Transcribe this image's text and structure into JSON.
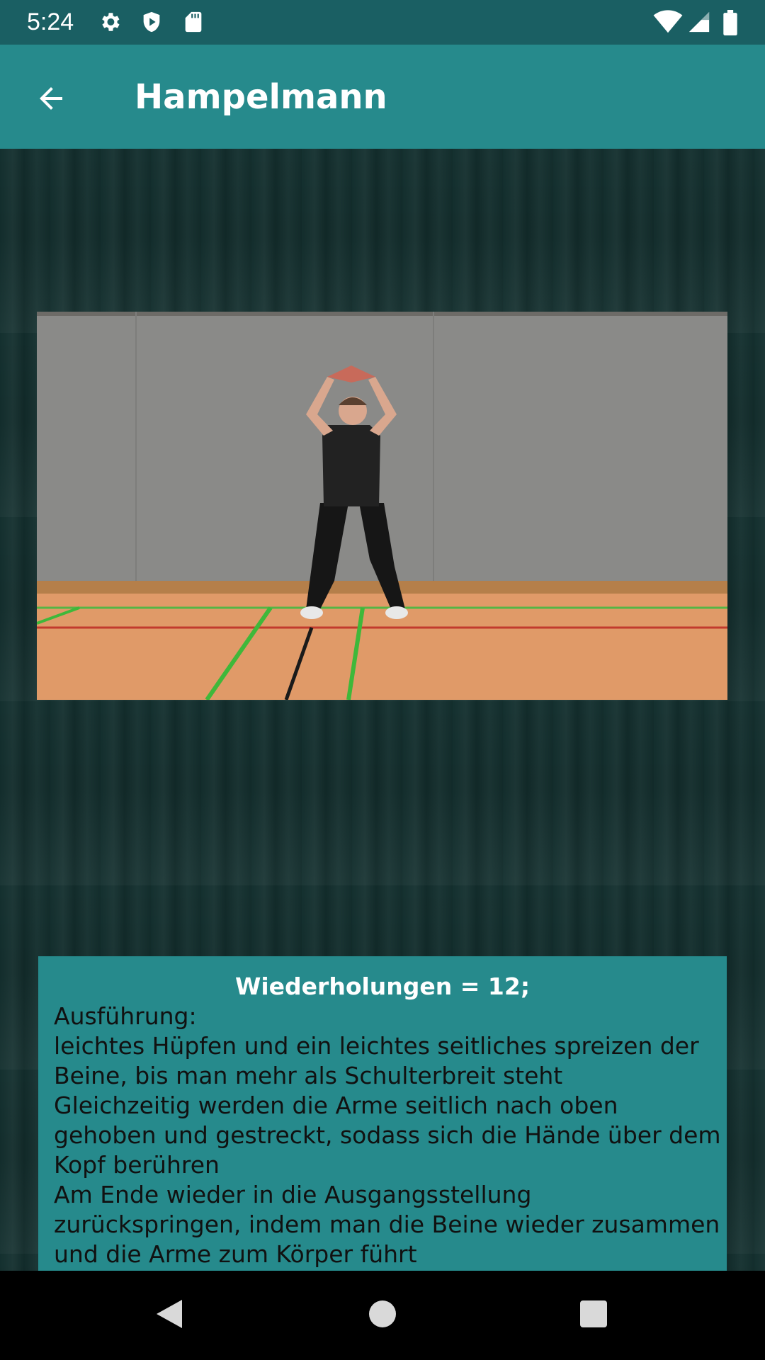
{
  "status_bar": {
    "time": "5:24",
    "left_icons": [
      "gear-icon",
      "shield-icon",
      "sd-card-icon"
    ],
    "right_icons": [
      "wifi-icon",
      "cellular-signal-icon",
      "battery-icon"
    ]
  },
  "app_bar": {
    "back_icon": "arrow-left-icon",
    "title": "Hampelmann"
  },
  "exercise": {
    "image_subject": "jumping-jack-photo"
  },
  "description": {
    "reps_heading": "Wiederholungen = 12;",
    "lines": [
      "Ausführung:",
      "leichtes Hüpfen und ein leichtes seitliches spreizen der",
      "Beine, bis man mehr als Schulterbreit steht",
      "Gleichzeitig werden die Arme seitlich nach oben",
      "gehoben und gestreckt, sodass sich die Hände über dem",
      "Kopf berühren",
      "Am Ende wieder in die Ausgangsstellung",
      "zurückspringen, indem man die Beine wieder zusammen",
      "und die Arme zum Körper führt"
    ]
  },
  "nav_bar": {
    "buttons": [
      "back-triangle-icon",
      "home-circle-icon",
      "recents-square-icon"
    ]
  },
  "colors": {
    "status_bar": "#1a5f63",
    "app_bar": "#268a8c",
    "background": "#14302f",
    "description_box": "#268a8c"
  }
}
